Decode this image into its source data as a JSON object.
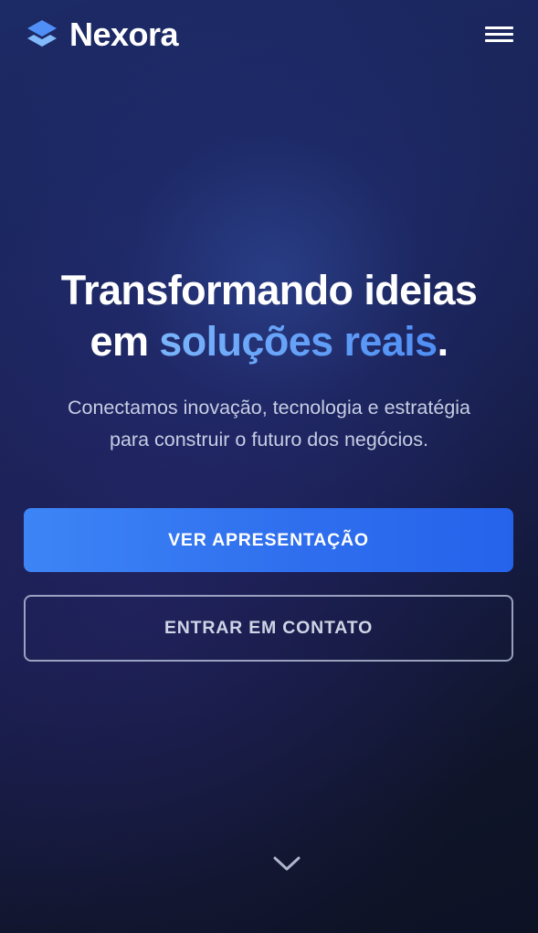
{
  "header": {
    "brand_name": "Nexora",
    "logo_icon": "layered-diamond-icon",
    "menu_icon": "hamburger-menu-icon"
  },
  "hero": {
    "title_line1": "Transformando ideias",
    "title_line2_prefix": "em ",
    "title_line2_accent": "soluções reais",
    "title_line2_suffix": ".",
    "subtitle_line1": "Conectamos inovação, tecnologia e estratégia",
    "subtitle_line2": "para construir o futuro dos negócios."
  },
  "actions": {
    "primary_label": "VER APRESENTAÇÃO",
    "secondary_label": "ENTRAR EM CONTATO"
  },
  "scroll_icon": "chevron-down-icon",
  "colors": {
    "accent": "#5b9cf8",
    "primary_button": "#3b82f6",
    "background_top": "#1c2a66",
    "background_bottom": "#0d1225"
  }
}
